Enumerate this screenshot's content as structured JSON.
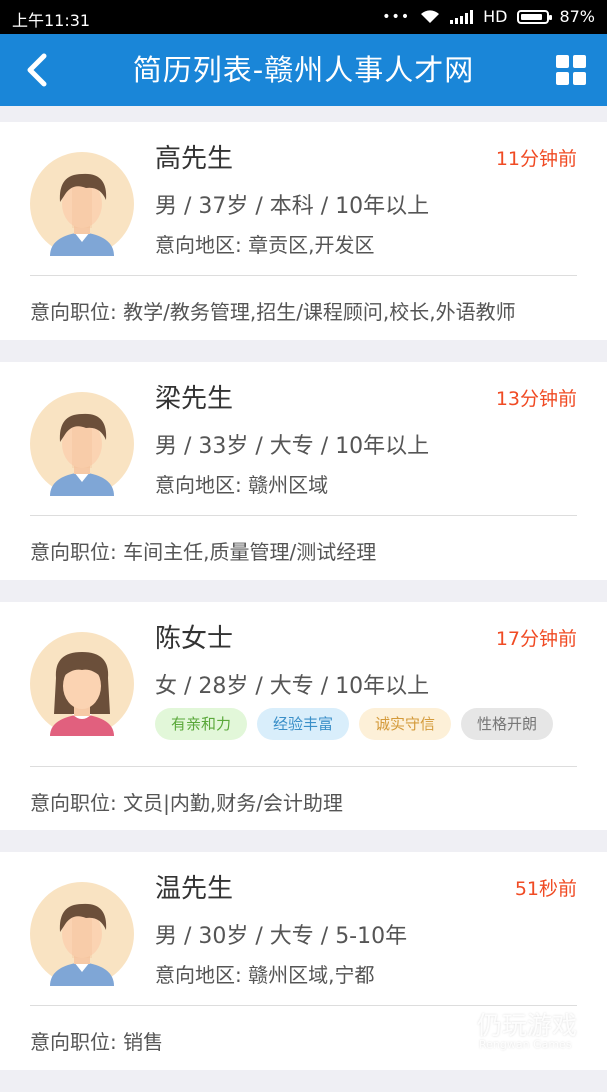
{
  "status_bar": {
    "time": "上午11:31",
    "dots": "•••",
    "network": "HD",
    "battery": "87%",
    "battery_level": 0.87
  },
  "app_bar": {
    "title": "简历列表-赣州人事人才网",
    "back_icon": "back-arrow-icon",
    "menu_icon": "grid-icon"
  },
  "resumes": [
    {
      "name": "高先生",
      "time": "11分钟前",
      "info": "男 / 37岁 / 本科 / 10年以上",
      "area": "意向地区: 章贡区,开发区",
      "position": "意向职位: 教学/教务管理,招生/课程顾问,校长,外语教师",
      "gender": "male"
    },
    {
      "name": "梁先生",
      "time": "13分钟前",
      "info": "男 / 33岁 / 大专 / 10年以上",
      "area": "意向地区: 赣州区域",
      "position": "意向职位: 车间主任,质量管理/测试经理",
      "gender": "male"
    },
    {
      "name": "陈女士",
      "time": "17分钟前",
      "info": "女 / 28岁 / 大专 / 10年以上",
      "tags": [
        {
          "label": "有亲和力",
          "bg": "#e2f7d9",
          "fg": "#5aa83a"
        },
        {
          "label": "经验丰富",
          "bg": "#d9eefb",
          "fg": "#3a8fc8"
        },
        {
          "label": "诚实守信",
          "bg": "#fdf0d8",
          "fg": "#d49a3a"
        },
        {
          "label": "性格开朗",
          "bg": "#e6e6e6",
          "fg": "#777777"
        }
      ],
      "position": "意向职位: 文员|内勤,财务/会计助理",
      "gender": "female"
    },
    {
      "name": "温先生",
      "time": "51秒前",
      "info": "男 / 30岁 / 大专 / 5-10年",
      "area": "意向地区: 赣州区域,宁都",
      "position": "意向职位: 销售",
      "gender": "male"
    }
  ],
  "watermark": {
    "cn": "仍玩游戏",
    "en": "Rengwan Games"
  },
  "colors": {
    "app_bar": "#1a86d8",
    "time_accent": "#f04b24",
    "background": "#efeff4"
  }
}
